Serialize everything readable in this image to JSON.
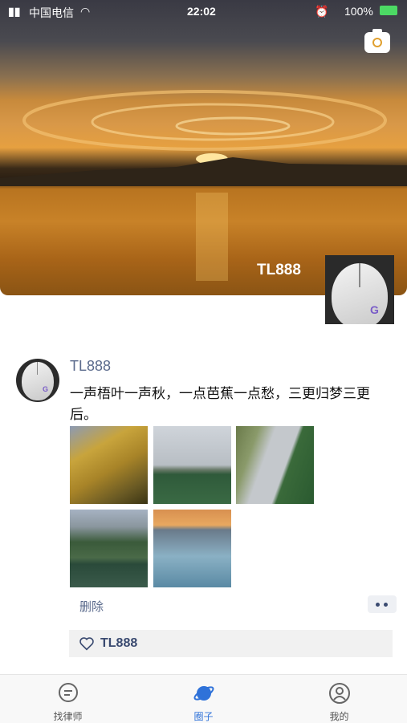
{
  "status_bar": {
    "carrier": "中国电信",
    "time": "22:02",
    "battery": "100%"
  },
  "profile": {
    "name": "TL888"
  },
  "post": {
    "username": "TL888",
    "text": "一声梧叶一声秋，一点芭蕉一点愁，三更归梦三更后。",
    "photos": [
      "ginkgo-tree",
      "lotus-pond-sky",
      "willow-lotus-pond",
      "mountain-lake",
      "sunset-horse-lake"
    ],
    "delete_label": "删除",
    "likes": "TL888"
  },
  "tabbar": {
    "tabs": [
      {
        "label": "找律师",
        "icon": "chat-bubble-icon"
      },
      {
        "label": "圈子",
        "icon": "planet-icon",
        "active": true
      },
      {
        "label": "我的",
        "icon": "user-icon"
      }
    ]
  },
  "colors": {
    "accent": "#2f72d9",
    "link": "#5a6a8c"
  }
}
